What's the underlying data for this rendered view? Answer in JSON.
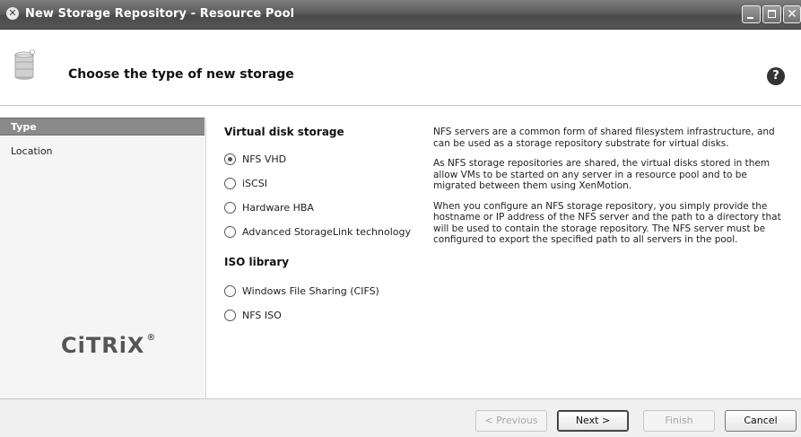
{
  "window": {
    "title": "New Storage Repository - Resource Pool",
    "app_icon": "x-server-icon",
    "app_icon_glyph": "✕",
    "close_glyph": "✕"
  },
  "header": {
    "title": "Choose the type of new storage",
    "help_glyph": "?"
  },
  "nav": {
    "items": [
      {
        "label": "Type",
        "active": true
      },
      {
        "label": "Location",
        "active": false
      }
    ],
    "logo_text": "CiTRiX",
    "logo_mark": "®"
  },
  "options": {
    "virtual_disk_title": "Virtual disk storage",
    "virtual_disk": [
      {
        "label": "NFS VHD",
        "checked": true
      },
      {
        "label": "iSCSI",
        "checked": false
      },
      {
        "label": "Hardware HBA",
        "checked": false
      },
      {
        "label": "Advanced StorageLink technology",
        "checked": false
      }
    ],
    "iso_title": "ISO library",
    "iso": [
      {
        "label": "Windows File Sharing (CIFS)",
        "checked": false
      },
      {
        "label": "NFS ISO",
        "checked": false
      }
    ]
  },
  "description": {
    "p1": "NFS servers are a common form of shared filesystem infrastructure, and can be used as a storage repository substrate for virtual disks.",
    "p2": "As NFS storage repositories are shared, the virtual disks stored in them allow VMs to be started on any server in a resource pool and to be migrated between them using XenMotion.",
    "p3": "When you configure an NFS storage repository, you simply provide the hostname or IP address of the NFS server and the path to a directory that will be used to contain the storage repository. The NFS server must be configured to export the specified path to all servers in the pool."
  },
  "footer": {
    "previous_label": "< Previous",
    "next_label": "Next >",
    "finish_label": "Finish",
    "cancel_label": "Cancel"
  }
}
